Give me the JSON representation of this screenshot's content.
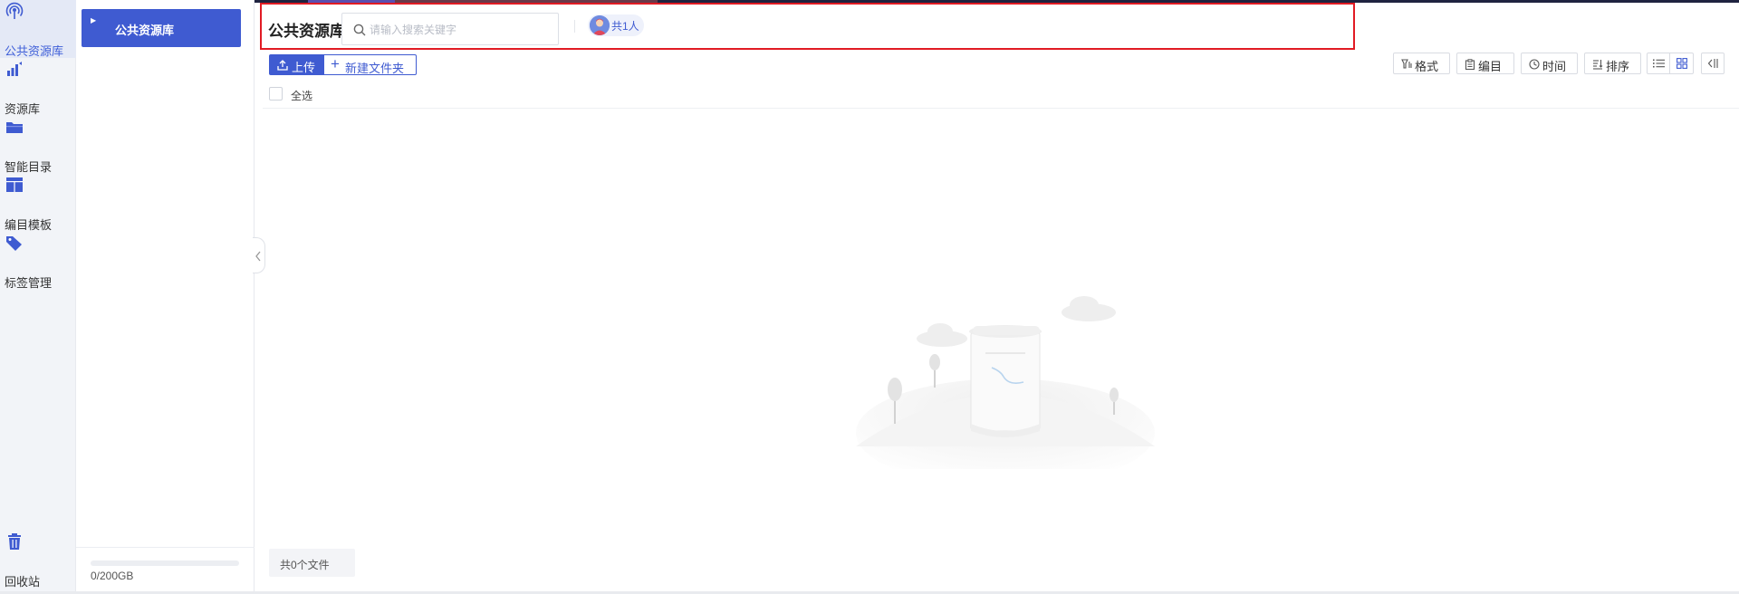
{
  "colors": {
    "accent": "#3f5bd1",
    "highlight_border": "#e11b24",
    "nav_bg": "#f2f4f8",
    "nav_active_bg": "#e4e9f6"
  },
  "left_nav": {
    "items": [
      {
        "icon": "broadcast-icon",
        "label": "公共资源库",
        "active": true
      },
      {
        "icon": "bar-chart-icon",
        "label": "资源库",
        "active": false
      },
      {
        "icon": "folder-icon",
        "label": "智能目录",
        "active": false
      },
      {
        "icon": "layout-icon",
        "label": "编目模板",
        "active": false
      },
      {
        "icon": "tag-icon",
        "label": "标签管理",
        "active": false
      }
    ],
    "recycle": {
      "icon": "trash-icon",
      "label": "回收站"
    }
  },
  "tree": {
    "root_label": "公共资源库",
    "storage_used_fraction": 0.0,
    "storage_text": "0/200GB"
  },
  "header": {
    "title": "公共资源库",
    "search_placeholder": "请输入搜索关键字",
    "search_value": "",
    "members_label": "共1人"
  },
  "toolbar": {
    "upload_label": "上传",
    "new_folder_label": "新建文件夹",
    "select_all_label": "全选",
    "format_label": "格式",
    "catalog_label": "编目",
    "time_label": "时间",
    "sort_label": "排序",
    "view_mode": "grid"
  },
  "footer": {
    "file_count_label": "共0个文件"
  }
}
